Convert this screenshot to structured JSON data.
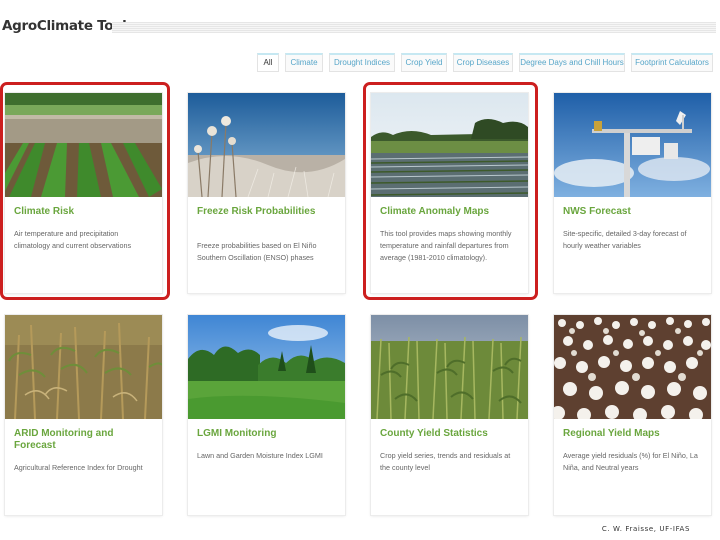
{
  "header": {
    "title": "AgroClimate Tools"
  },
  "filters": [
    {
      "label": "All",
      "active": true
    },
    {
      "label": "Climate"
    },
    {
      "label": "Drought Indices"
    },
    {
      "label": "Crop Yield"
    },
    {
      "label": "Crop Diseases"
    },
    {
      "label": "Degree Days and Chill Hours"
    },
    {
      "label": "Footprint Calculators"
    }
  ],
  "cards": [
    {
      "title": "Climate Risk",
      "description": "Air temperature and precipitation climatology and current observations",
      "highlighted": true,
      "image": "flooded-crop-field-photo"
    },
    {
      "title": "Freeze Risk Probabilities",
      "description": "Freeze probabilities based on El Niño Southern Oscillation (ENSO) phases",
      "highlighted": false,
      "image": "frosted-plants-photo"
    },
    {
      "title": "Climate Anomaly Maps",
      "description": "This tool provides maps showing monthly temperature and rainfall departures from average (1981-2010 climatology).",
      "highlighted": true,
      "image": "waterlogged-field-photo"
    },
    {
      "title": "NWS Forecast",
      "description": "Site-specific, detailed 3-day forecast of hourly weather variables",
      "highlighted": false,
      "image": "weather-station-photo"
    },
    {
      "title": "ARID Monitoring and Forecast",
      "description": "Agricultural Reference Index for Drought",
      "highlighted": false,
      "image": "dry-corn-photo"
    },
    {
      "title": "LGMI Monitoring",
      "description": "Lawn and Garden Moisture Index LGMI",
      "highlighted": false,
      "image": "green-lawn-photo"
    },
    {
      "title": "County Yield Statistics",
      "description": "Crop yield series, trends and residuals at the county level",
      "highlighted": false,
      "image": "corn-field-photo"
    },
    {
      "title": "Regional Yield Maps",
      "description": "Average yield residuals (%) for El Niño, La Niña, and Neutral years",
      "highlighted": false,
      "image": "cotton-field-photo"
    }
  ],
  "credit": "C. W. Fraisse, UF-IFAS",
  "colors": {
    "card_title": "#6aa63e",
    "filter_text": "#57a6c9",
    "highlight_border": "#cc1f1f"
  }
}
